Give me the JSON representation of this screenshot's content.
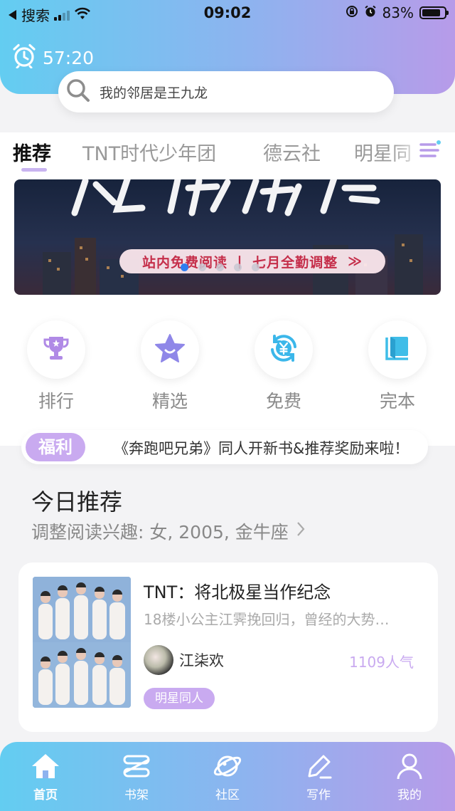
{
  "status_bar": {
    "carrier": "搜索",
    "time": "09:02",
    "battery": "83%",
    "battery_level": 0.83
  },
  "timer": {
    "value": "57:20"
  },
  "search": {
    "placeholder": "我的邻居是王九龙"
  },
  "tabs": [
    {
      "label": "推荐",
      "active": true
    },
    {
      "label": "TNT时代少年团",
      "active": false
    },
    {
      "label": "德云社",
      "active": false
    },
    {
      "label": "明星同",
      "active": false
    }
  ],
  "banner": {
    "pill_text": "站内免费阅读 丨 七月全勤调整",
    "pill_arrow": "≫",
    "slide_count": 5,
    "active_slide": 1
  },
  "quick_entries": [
    {
      "label": "排行",
      "icon": "trophy-icon",
      "color": "#b08ae6"
    },
    {
      "label": "精选",
      "icon": "star-icon",
      "color": "#8f87e8"
    },
    {
      "label": "免费",
      "icon": "yuan-refresh-icon",
      "color": "#3bb7ea"
    },
    {
      "label": "完本",
      "icon": "book-icon",
      "color": "#3fbde8"
    }
  ],
  "notice": {
    "badge": "福利",
    "text": "《奔跑吧兄弟》同人开新书&推荐奖励来啦！"
  },
  "recommend": {
    "title": "今日推荐",
    "subtitle": "调整阅读兴趣: 女, 2005, 金牛座",
    "chevron": "›"
  },
  "book": {
    "title": "TNT：将北极星当作纪念",
    "description": "18楼小公主江霁挽回归，曾经的大势…",
    "author": "江柒欢",
    "popularity": "1109人气",
    "tag": "明星同人"
  },
  "bottom_nav": [
    {
      "label": "首页",
      "icon": "home-icon",
      "active": true
    },
    {
      "label": "书架",
      "icon": "bookshelf-icon",
      "active": false
    },
    {
      "label": "社区",
      "icon": "planet-icon",
      "active": false
    },
    {
      "label": "写作",
      "icon": "pen-icon",
      "active": false
    },
    {
      "label": "我的",
      "icon": "user-icon",
      "active": false
    }
  ],
  "colors": {
    "gradient_start": "#63cdf1",
    "gradient_end": "#b79be9",
    "accent": "#c9aaf0",
    "dot_active": "#2e7df0"
  }
}
